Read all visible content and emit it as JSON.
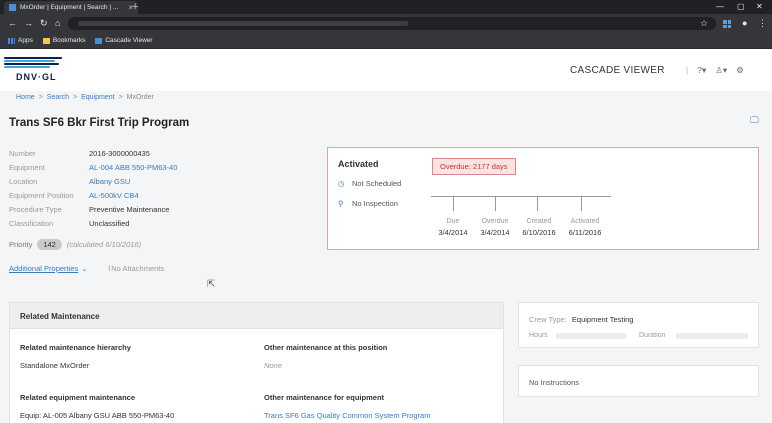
{
  "browser": {
    "tab_title": "MxOrder | Equipment | Search | ...",
    "bookmarks": [
      "Apps",
      "Bookmarks",
      "Cascade Viewer"
    ]
  },
  "header": {
    "logo_text": "DNV·GL",
    "app_title": "CASCADE VIEWER"
  },
  "breadcrumb": [
    "Home",
    "Search",
    "Equipment",
    "MxOrder"
  ],
  "page_title": "Trans SF6 Bkr First Trip Program",
  "properties": [
    {
      "label": "Number",
      "value": "2016-3000000435",
      "link": false
    },
    {
      "label": "Equipment",
      "value": "AL-004 ABB 550-PM63-40",
      "link": true
    },
    {
      "label": "Location",
      "value": "Albany GSU",
      "link": true
    },
    {
      "label": "Equipment Position",
      "value": "AL-500kV CB4",
      "link": true
    },
    {
      "label": "Procedure Type",
      "value": "Preventive Maintenance",
      "link": false
    },
    {
      "label": "Classification",
      "value": "Unclassified",
      "link": false
    }
  ],
  "priority": {
    "label": "Priority",
    "value": "142",
    "note": "(calculated 6/10/2016)"
  },
  "links": {
    "additional_properties": "Additional Properties",
    "no_attachments": "No Attachments"
  },
  "status": {
    "title": "Activated",
    "overdue_badge": "Overdue: 2177 days",
    "items": [
      "Not Scheduled",
      "No Inspection"
    ],
    "timeline": [
      {
        "label": "Due",
        "date": "3/4/2014"
      },
      {
        "label": "Overdue",
        "date": "3/4/2014"
      },
      {
        "label": "Created",
        "date": "6/10/2016"
      },
      {
        "label": "Activated",
        "date": "6/11/2016"
      }
    ]
  },
  "related": {
    "title": "Related Maintenance",
    "cells": [
      {
        "title": "Related maintenance hierarchy",
        "body": "Standalone MxOrder",
        "style": ""
      },
      {
        "title": "Other maintenance at this position",
        "body": "None",
        "style": "em"
      },
      {
        "title": "Related equipment maintenance",
        "body": "Equip: AL-005   Albany GSU   ABB   550-PM63-40",
        "style": ""
      },
      {
        "title": "Other maintenance for equipment",
        "body": "Trans SF6 Gas Quality Common System Program",
        "style": "link"
      }
    ]
  },
  "crew": {
    "crew_type_label": "Crew Type:",
    "crew_type_value": "Equipment Testing",
    "hours_label": "Hours",
    "duration_label": "Duration"
  },
  "instructions": "No Instructions"
}
